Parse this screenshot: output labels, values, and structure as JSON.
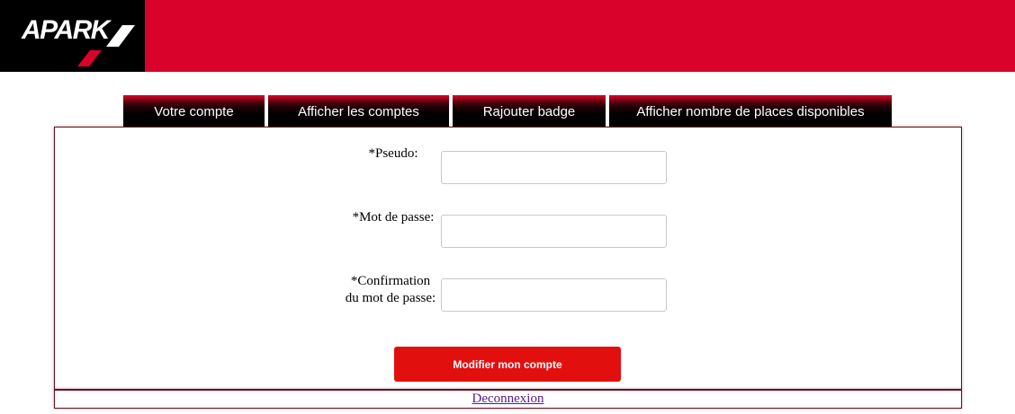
{
  "header": {
    "logo_text": "APARK",
    "colors": {
      "banner": "#d9022a",
      "logo_bg": "#000000"
    }
  },
  "tabs": [
    {
      "label": "Votre compte"
    },
    {
      "label": "Afficher les comptes"
    },
    {
      "label": "Rajouter badge"
    },
    {
      "label": "Afficher nombre de places disponibles"
    }
  ],
  "form": {
    "fields": [
      {
        "label": "*Pseudo:",
        "value": "",
        "placeholder": ""
      },
      {
        "label": "*Mot de passe:",
        "value": "",
        "placeholder": ""
      },
      {
        "label": "*Confirmation du mot de passe:",
        "value": "",
        "placeholder": ""
      }
    ],
    "submit_label": "Modifier mon compte",
    "submit_color": "#e20f0f"
  },
  "footer": {
    "logout_label": "Deconnexion"
  }
}
